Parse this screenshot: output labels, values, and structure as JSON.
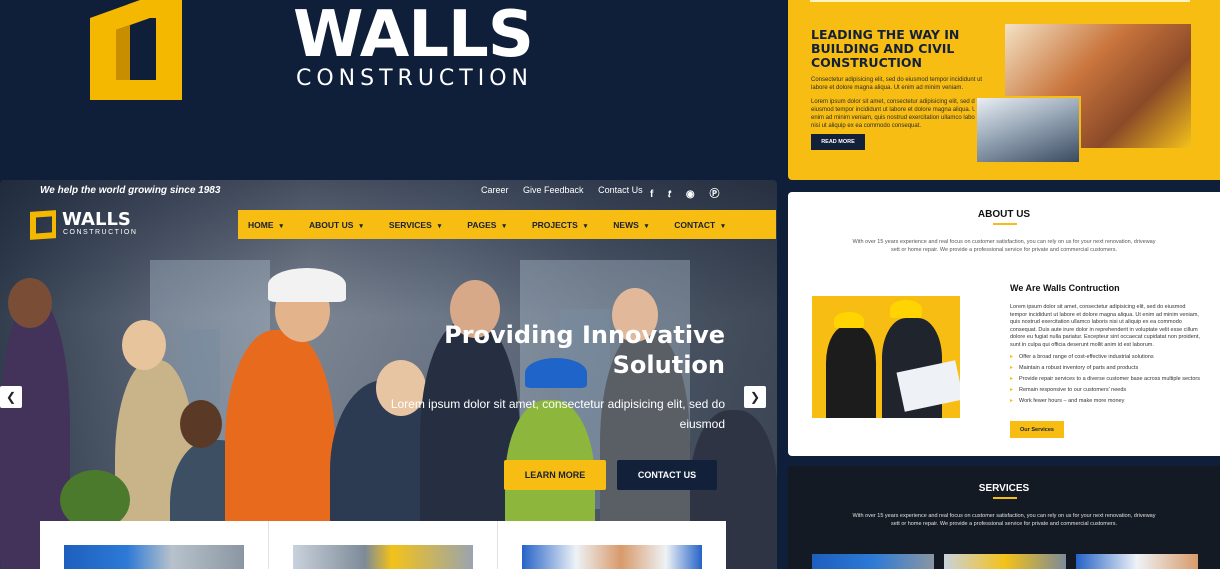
{
  "brand": {
    "wordmark": "WALLS",
    "subtitle": "CONSTRUCTION"
  },
  "site": {
    "tagline": "We help the world growing since 1983",
    "top_links": [
      "Career",
      "Give Feedback",
      "Contact Us"
    ],
    "social_icons": [
      "facebook-icon",
      "twitter-icon",
      "instagram-icon",
      "pinterest-icon"
    ],
    "logo": {
      "word": "WALLS",
      "sub": "CONSTRUCTION"
    },
    "nav": [
      "HOME",
      "ABOUT US",
      "SERVICES",
      "PAGES",
      "PROJECTS",
      "NEWS",
      "CONTACT"
    ],
    "hero": {
      "title": "Providing Innovative Solution",
      "text": "Lorem ipsum dolor sit amet, consectetur adipisicing elit, sed do eiusmod",
      "learn_more": "LEARN MORE",
      "contact_us": "CONTACT US"
    }
  },
  "yellow_panel": {
    "title": "LEADING THE WAY IN BUILDING AND CIVIL CONSTRUCTION",
    "p1": "Consectetur adipisicing elit, sed do eiusmod tempor incididunt ut labore et dolore magna aliqua. Ut enim ad minim veniam.",
    "p2": "Lorem ipsum dolor sit amet, consectetur adipisicing elit, sed do eiusmod tempor incididunt ut labore et dolore magna aliqua. Ut enim ad minim veniam, quis nostrud exercitation ullamco laboris nisi ut aliquip ex ea commodo consequat.",
    "button": "READ MORE"
  },
  "about_panel": {
    "title": "ABOUT US",
    "intro": "With over 15 years experience and real focus on customer satisfaction, you can rely on us for your next renovation, driveway sett or home repair. We provide a professional service for private and commercial customers.",
    "heading": "We Are Walls Contruction",
    "paragraph": "Lorem ipsum dolor sit amet, consectetur adipisicing elit, sed do eiusmod tempor incididunt ut labore et dolore magna aliqua. Ut enim ad minim veniam, quis nostrud exercitation ullamco laboris nisi ut aliquip ex ea commodo consequat. Duis aute irure dolor in reprehenderit in voluptate velit esse cillum dolore eu fugiat nulla pariatur. Excepteur sint occaecat cupidatat non proident, sunt in culpa qui officia deserunt mollit anim id est laborum.",
    "list": [
      "Offer a broad range of cost-effective industrial solutions",
      "Maintain a robust inventory of parts and products",
      "Provide repair services to a diverse customer base across multiple sectors",
      "Remain responsive to our customers' needs",
      "Work fewer hours – and make more money"
    ],
    "button": "Our Services"
  },
  "services_panel": {
    "title": "SERVICES",
    "intro": "With over 15 years experience and real focus on customer satisfaction, you can rely on us for your next renovation, driveway sett or home repair. We provide a professional service for private and commercial customers."
  },
  "colors": {
    "navy": "#0f1f3a",
    "yellow": "#f7bd12",
    "dark": "#141a24"
  }
}
